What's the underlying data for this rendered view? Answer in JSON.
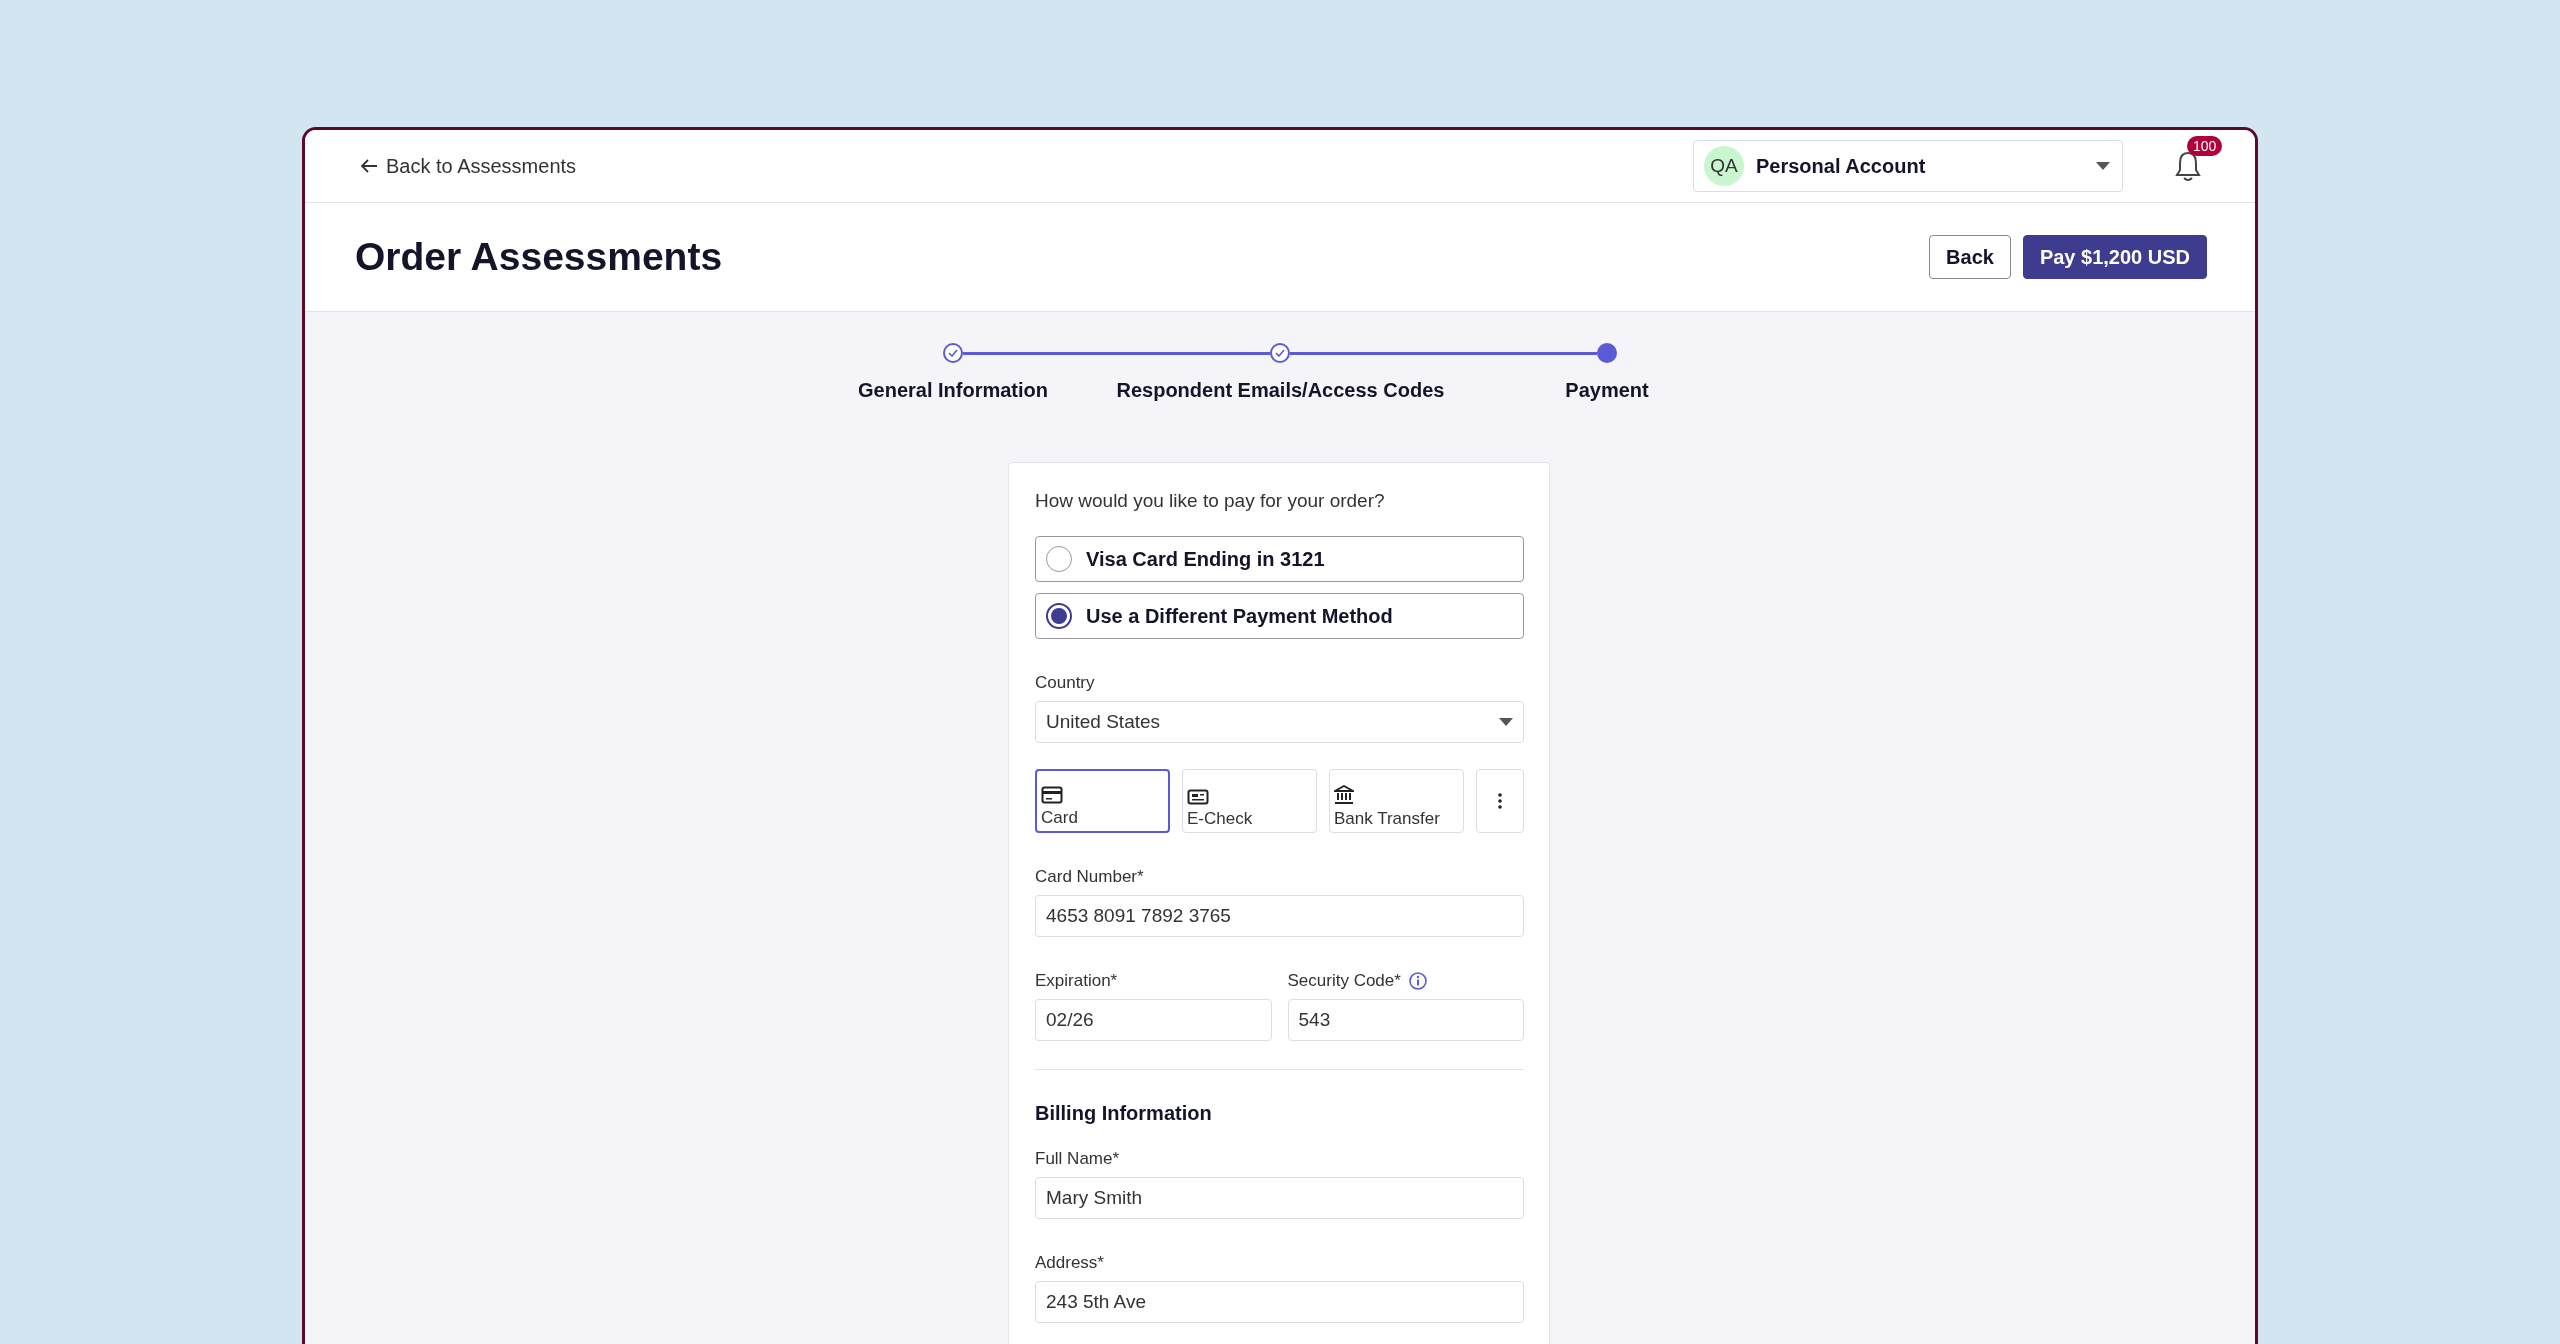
{
  "header": {
    "back_link": "Back to Assessments",
    "account": {
      "initials": "QA",
      "name": "Personal Account"
    },
    "notifications": {
      "count": "100"
    }
  },
  "title": "Order Assessments",
  "actions": [
    {
      "label": "Back",
      "kind": "secondary"
    },
    {
      "label": "Pay $1,200 USD",
      "kind": "primary"
    }
  ],
  "steps": [
    {
      "label": "General Information",
      "completed": true
    },
    {
      "label": "Respondent Emails/Access Codes",
      "completed": true
    },
    {
      "label": "Payment",
      "completed": false
    }
  ],
  "payment": {
    "question": "How would you like to pay for your order?",
    "options": [
      {
        "label": "Visa Card Ending in 3121",
        "selected": false
      },
      {
        "label": "Use a Different Payment Method",
        "selected": true
      }
    ],
    "country": {
      "label": "Country",
      "value": "United States"
    },
    "methods": [
      {
        "label": "Card",
        "kind": "card",
        "selected": true
      },
      {
        "label": "E-Check",
        "kind": "check",
        "selected": false
      },
      {
        "label": "Bank Transfer",
        "kind": "bank",
        "selected": false
      }
    ],
    "card_number": {
      "label": "Card Number*",
      "value": "4653 8091 7892 3765"
    },
    "expiration": {
      "label": "Expiration*",
      "value": "02/26"
    },
    "security_code": {
      "label": "Security Code*",
      "value": "543"
    }
  },
  "billing": {
    "heading": "Billing Information",
    "fields": [
      {
        "label": "Full Name*",
        "value": "Mary Smith"
      },
      {
        "label": "Address*",
        "value": "243 5th Ave"
      }
    ]
  }
}
